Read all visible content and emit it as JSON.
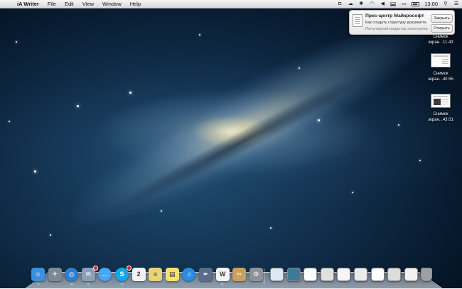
{
  "menubar": {
    "apple": "",
    "app_name": "iA Writer",
    "menus": [
      "File",
      "Edit",
      "View",
      "Window",
      "Help"
    ],
    "clock": "13:00"
  },
  "notification": {
    "title": "Прес-центр Майкрософт",
    "subtitle": "Как создать структуру документа",
    "body": "Популярный редактор электронных таблиц",
    "close_label": "Закрыть",
    "open_label": "Открыть"
  },
  "desktop_files": [
    {
      "line1": "Снимок",
      "line2": "экран...11.43"
    },
    {
      "line1": "Снимок",
      "line2": "экран...40.55"
    },
    {
      "line1": "Снимок",
      "line2": "экран...43.01"
    }
  ],
  "dock": {
    "apps": [
      {
        "name": "finder-icon",
        "glyph": "☺",
        "color": "#3c8fd8",
        "running": true
      },
      {
        "name": "launchpad-icon",
        "glyph": "✈",
        "color": "#7d8a96",
        "running": false
      },
      {
        "name": "safari-icon",
        "glyph": "◎",
        "color": "#2f7fd1",
        "running": true
      },
      {
        "name": "mail-icon",
        "glyph": "✉",
        "color": "#8aa0b8",
        "running": true
      },
      {
        "name": "messages-icon",
        "glyph": "…",
        "color": "#4ba5f0",
        "running": false
      },
      {
        "name": "skype-icon",
        "glyph": "S",
        "color": "#1aa5e8",
        "running": true
      },
      {
        "name": "calendar-icon",
        "glyph": "2",
        "color": "#f2f2f2",
        "running": false
      },
      {
        "name": "notes-icon",
        "glyph": "≡",
        "color": "#e9d27a",
        "running": false
      },
      {
        "name": "stickies-icon",
        "glyph": "▤",
        "color": "#f1e36e",
        "running": false
      },
      {
        "name": "itunes-icon",
        "glyph": "♫",
        "color": "#2c8ce0",
        "running": false
      },
      {
        "name": "quill-icon",
        "glyph": "✒",
        "color": "#5a6c8a",
        "running": false
      },
      {
        "name": "ia-writer-icon",
        "glyph": "W",
        "color": "#f4f4f4",
        "running": true
      },
      {
        "name": "scripting-icon",
        "glyph": "✂",
        "color": "#c9a060",
        "running": false
      },
      {
        "name": "system-preferences-icon",
        "glyph": "⚙",
        "color": "#8f9399",
        "running": false
      }
    ],
    "stack": [
      {
        "name": "documents-stack-icon",
        "color": "#dfe7f2"
      },
      {
        "name": "document-thumb-icon",
        "color": "#3c7a95"
      },
      {
        "name": "screenshot-thumb-icon",
        "color": "#ffffff"
      },
      {
        "name": "screenshot-thumb-2-icon",
        "color": "#e0e0e0"
      },
      {
        "name": "screenshot-thumb-3-icon",
        "color": "#f6f6f6"
      },
      {
        "name": "screenshot-thumb-4-icon",
        "color": "#eaeaea"
      },
      {
        "name": "screenshot-thumb-5-icon",
        "color": "#ffffff"
      },
      {
        "name": "screenshot-thumb-6-icon",
        "color": "#dcdcdc"
      },
      {
        "name": "screenshot-thumb-7-icon",
        "color": "#f2f2f2"
      },
      {
        "name": "trash-icon",
        "color": "#9aa0a6"
      }
    ]
  }
}
